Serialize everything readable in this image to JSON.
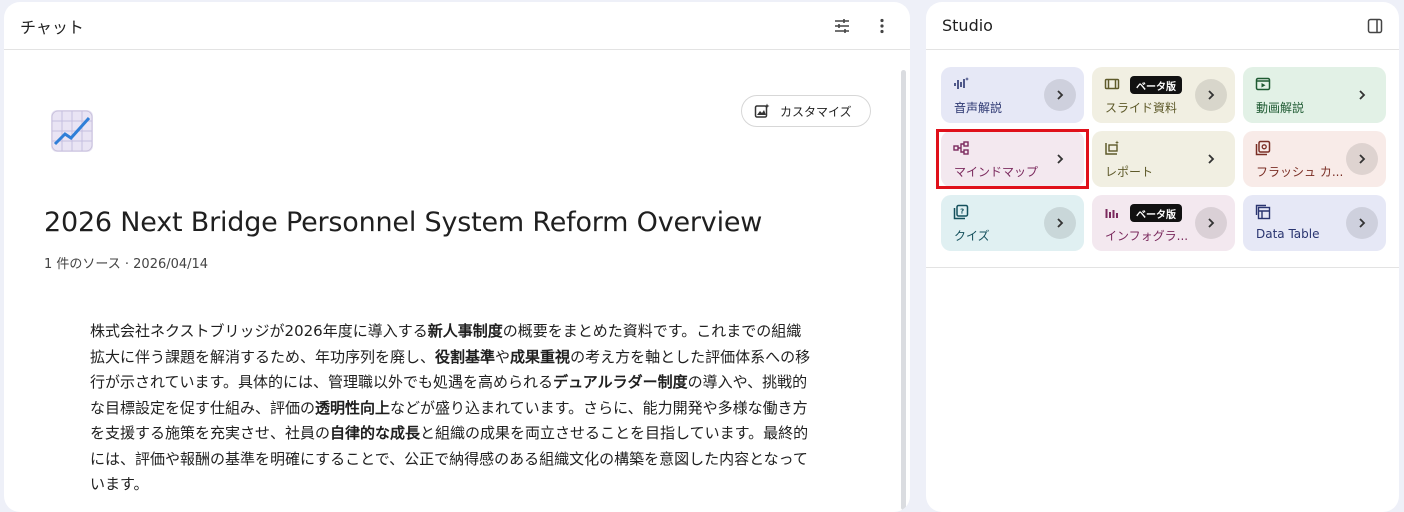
{
  "chat": {
    "title": "チャット",
    "customize_label": "カスタマイズ",
    "doc_title": "2026 Next Bridge Personnel System Reform Overview",
    "doc_meta": "1 件のソース · 2026/04/14",
    "summary": [
      {
        "t": "株式会社ネクストブリッジが2026年度に導入する",
        "b": false
      },
      {
        "t": "新人事制度",
        "b": true
      },
      {
        "t": "の概要をまとめた資料です。これまでの組織拡大に伴う課題を解消するため、年功序列を廃し、",
        "b": false
      },
      {
        "t": "役割基準",
        "b": true
      },
      {
        "t": "や",
        "b": false
      },
      {
        "t": "成果重視",
        "b": true
      },
      {
        "t": "の考え方を軸とした評価体系への移行が示されています。具体的には、管理職以外でも処遇を高められる",
        "b": false
      },
      {
        "t": "デュアルラダー制度",
        "b": true
      },
      {
        "t": "の導入や、挑戦的な目標設定を促す仕組み、評価の",
        "b": false
      },
      {
        "t": "透明性向上",
        "b": true
      },
      {
        "t": "などが盛り込まれています。さらに、能力開発や多様な働き方を支援する施策を充実させ、社員の",
        "b": false
      },
      {
        "t": "自律的な成長",
        "b": true
      },
      {
        "t": "と組織の成果を両立させることを目指しています。最終的には、評価や報酬の基準を明確にすることで、公正で納得感のある組織文化の構築を意図した内容となっています。",
        "b": false
      }
    ]
  },
  "studio": {
    "title": "Studio",
    "tiles": [
      {
        "label": "音声解説",
        "icon": "audio-waveform-icon",
        "bg": "#e6e8f6",
        "fg": "#2a3570",
        "arrow_filled": true,
        "beta": ""
      },
      {
        "label": "スライド資料",
        "icon": "slides-icon",
        "bg": "#f1efe2",
        "fg": "#5e5a2a",
        "arrow_filled": true,
        "beta": "ベータ版"
      },
      {
        "label": "動画解説",
        "icon": "video-icon",
        "bg": "#e2f1e6",
        "fg": "#1e5a32",
        "arrow_filled": false,
        "beta": ""
      },
      {
        "label": "マインドマップ",
        "icon": "mindmap-icon",
        "bg": "#f3e8ef",
        "fg": "#7b2a5e",
        "arrow_filled": false,
        "beta": ""
      },
      {
        "label": "レポート",
        "icon": "report-icon",
        "bg": "#f1efe2",
        "fg": "#5e5a2a",
        "arrow_filled": false,
        "beta": ""
      },
      {
        "label": "フラッシュ カ...",
        "icon": "flashcard-icon",
        "bg": "#f8ebe8",
        "fg": "#7a2e25",
        "arrow_filled": true,
        "beta": ""
      },
      {
        "label": "クイズ",
        "icon": "quiz-icon",
        "bg": "#e0f0f2",
        "fg": "#14505c",
        "arrow_filled": true,
        "beta": ""
      },
      {
        "label": "インフォグラ...",
        "icon": "infographic-icon",
        "bg": "#f3e8ef",
        "fg": "#7b2a5e",
        "arrow_filled": true,
        "beta": "ベータ版"
      },
      {
        "label": "Data Table",
        "icon": "table-icon",
        "bg": "#e6e8f6",
        "fg": "#2a3570",
        "arrow_filled": true,
        "beta": ""
      }
    ]
  }
}
